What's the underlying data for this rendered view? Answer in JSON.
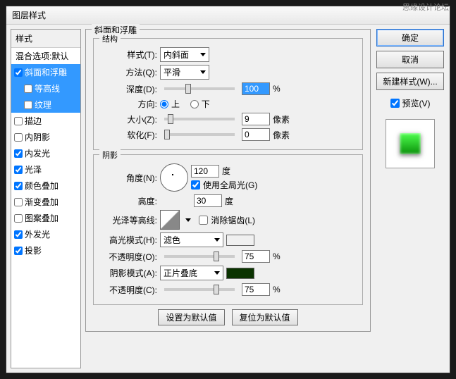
{
  "watermark": "思缘设计论坛",
  "dialog_title": "图层样式",
  "styles_panel": {
    "header": "样式",
    "blend_options": "混合选项:默认",
    "items": [
      {
        "label": "斜面和浮雕",
        "checked": true,
        "selected": true
      },
      {
        "label": "等高线",
        "checked": false,
        "selected": true,
        "indent": true
      },
      {
        "label": "纹理",
        "checked": false,
        "selected": true,
        "indent": true
      },
      {
        "label": "描边",
        "checked": false
      },
      {
        "label": "内阴影",
        "checked": false
      },
      {
        "label": "内发光",
        "checked": true
      },
      {
        "label": "光泽",
        "checked": true
      },
      {
        "label": "颜色叠加",
        "checked": true
      },
      {
        "label": "渐变叠加",
        "checked": false
      },
      {
        "label": "图案叠加",
        "checked": false
      },
      {
        "label": "外发光",
        "checked": true
      },
      {
        "label": "投影",
        "checked": true
      }
    ]
  },
  "main": {
    "title": "斜面和浮雕",
    "structure": {
      "legend": "结构",
      "style_label": "样式(T):",
      "style_value": "内斜面",
      "method_label": "方法(Q):",
      "method_value": "平滑",
      "depth_label": "深度(D):",
      "depth_value": "100",
      "depth_unit": "%",
      "direction_label": "方向:",
      "dir_up": "上",
      "dir_down": "下",
      "size_label": "大小(Z):",
      "size_value": "9",
      "size_unit": "像素",
      "soften_label": "软化(F):",
      "soften_value": "0",
      "soften_unit": "像素"
    },
    "shading": {
      "legend": "阴影",
      "angle_label": "角度(N):",
      "angle_value": "120",
      "angle_unit": "度",
      "global_light": "使用全局光(G)",
      "altitude_label": "高度:",
      "altitude_value": "30",
      "altitude_unit": "度",
      "gloss_label": "光泽等高线:",
      "antialias": "消除锯齿(L)",
      "highlight_mode_label": "高光模式(H):",
      "highlight_mode_value": "滤色",
      "highlight_opacity_label": "不透明度(O):",
      "highlight_opacity_value": "75",
      "highlight_opacity_unit": "%",
      "shadow_mode_label": "阴影模式(A):",
      "shadow_mode_value": "正片叠底",
      "shadow_opacity_label": "不透明度(C):",
      "shadow_opacity_value": "75",
      "shadow_opacity_unit": "%",
      "highlight_color": "#ffffff",
      "shadow_color": "#0a3300"
    },
    "set_default": "设置为默认值",
    "reset_default": "复位为默认值"
  },
  "buttons": {
    "ok": "确定",
    "cancel": "取消",
    "new_style": "新建样式(W)...",
    "preview": "预览(V)"
  }
}
